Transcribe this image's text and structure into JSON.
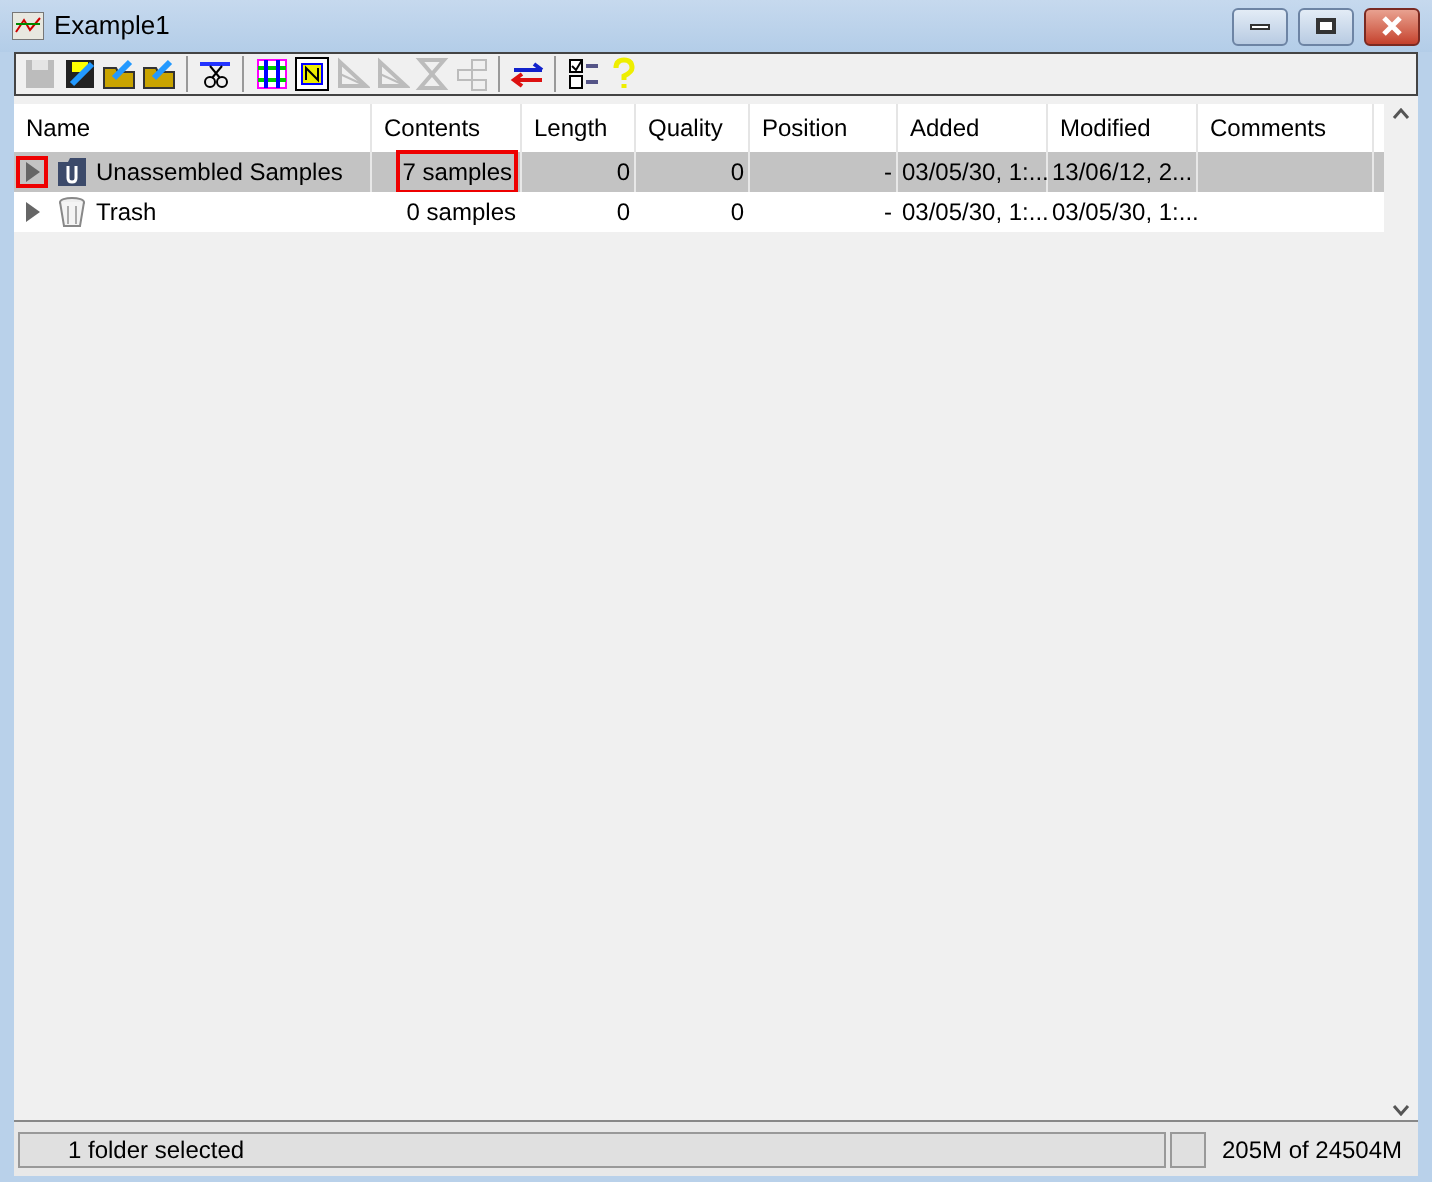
{
  "window": {
    "title": "Example1"
  },
  "toolbar": [
    {
      "kind": "button",
      "disabled": true
    },
    {
      "kind": "button",
      "disabled": false
    },
    {
      "kind": "button",
      "disabled": false
    },
    {
      "kind": "button",
      "disabled": false
    },
    {
      "kind": "separator"
    },
    {
      "kind": "button",
      "disabled": false
    },
    {
      "kind": "separator"
    },
    {
      "kind": "button",
      "disabled": false
    },
    {
      "kind": "button",
      "disabled": false
    },
    {
      "kind": "button",
      "disabled": true
    },
    {
      "kind": "button",
      "disabled": true
    },
    {
      "kind": "button",
      "disabled": true
    },
    {
      "kind": "button",
      "disabled": true
    },
    {
      "kind": "separator"
    },
    {
      "kind": "button",
      "disabled": false
    },
    {
      "kind": "separator"
    },
    {
      "kind": "button",
      "disabled": false
    },
    {
      "kind": "button",
      "disabled": false
    }
  ],
  "table": {
    "columns": [
      "Name",
      "Contents",
      "Length",
      "Quality",
      "Position",
      "Added",
      "Modified",
      "Comments"
    ],
    "rows": [
      {
        "kind": "folder",
        "selected": true,
        "expanded": false,
        "toggle_highlighted": true,
        "cells": [
          {
            "text": "Unassembled Samples",
            "highlighted": false
          },
          {
            "text": "7 samples",
            "highlighted": true
          },
          {
            "text": "0",
            "highlighted": false
          },
          {
            "text": "0",
            "highlighted": false
          },
          {
            "text": "-",
            "highlighted": false
          },
          {
            "text": "03/05/30, 1:...",
            "highlighted": false
          },
          {
            "text": "13/06/12, 2...",
            "highlighted": false
          }
        ]
      },
      {
        "kind": "trash",
        "selected": false,
        "expanded": false,
        "toggle_highlighted": false,
        "cells": [
          {
            "text": "Trash",
            "highlighted": false
          },
          {
            "text": "0 samples",
            "highlighted": false
          },
          {
            "text": "0",
            "highlighted": false
          },
          {
            "text": "0",
            "highlighted": false
          },
          {
            "text": "-",
            "highlighted": false
          },
          {
            "text": "03/05/30, 1:...",
            "highlighted": false
          },
          {
            "text": "03/05/30, 1:...",
            "highlighted": false
          }
        ]
      }
    ]
  },
  "status_bar": {
    "message": "1 folder selected",
    "memory": "205M of 24504M"
  }
}
